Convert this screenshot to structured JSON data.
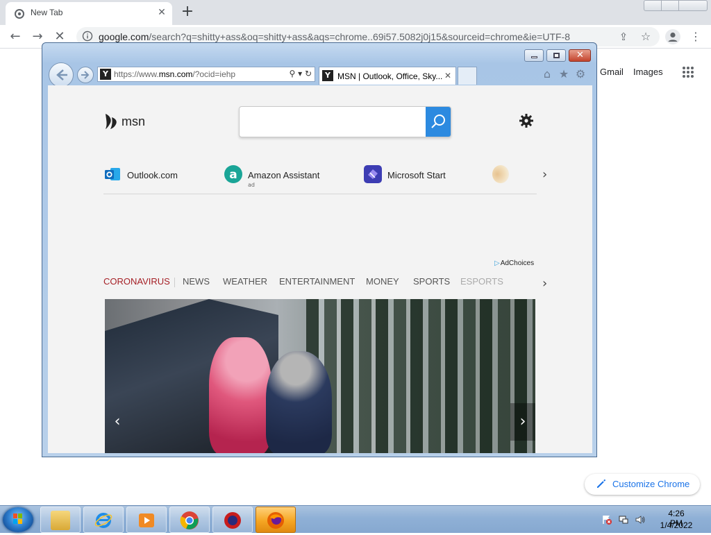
{
  "chrome": {
    "tab_title": "New Tab",
    "new_tab_glyph": "+",
    "omnibox": {
      "host": "google.com",
      "path": "/search?q=shitty+ass&oq=shitty+ass&aqs=chrome..69i57.5082j0j15&sourceid=chrome&ie=UTF-8"
    },
    "google_links": [
      "Gmail",
      "Images"
    ],
    "customize_label": "Customize Chrome"
  },
  "ie": {
    "address_prefix": "https://www.",
    "address_host": "msn.com",
    "address_path": "/?ocid=iehp",
    "tab_title": "MSN | Outlook, Office, Sky...",
    "tab_close": "✕",
    "favicon_letter": "Y"
  },
  "msn": {
    "logo_text": "msn",
    "search": {
      "value": "",
      "placeholder": ""
    },
    "tiles": [
      {
        "label": "Outlook.com",
        "icon": "outlook-icon",
        "color": "#0f6cbd",
        "ad": ""
      },
      {
        "label": "Amazon Assistant",
        "icon": "amazon-assistant-icon",
        "color": "#1aa597",
        "ad": "ad"
      },
      {
        "label": "Microsoft Start",
        "icon": "microsoft-start-icon",
        "color": "#4b4bc4",
        "ad": ""
      }
    ],
    "adchoices": "AdChoices",
    "nav": [
      "CORONAVIRUS",
      "NEWS",
      "WEATHER",
      "ENTERTAINMENT",
      "MONEY",
      "SPORTS",
      "ESPORTS"
    ],
    "accent": "#a51f25",
    "search_button_color": "#2c8ae0"
  },
  "taskbar": {
    "apps": [
      "file-explorer-icon",
      "internet-explorer-icon",
      "media-player-icon",
      "chrome-icon",
      "app-icon",
      "firefox-icon"
    ],
    "time": "4:26 PM",
    "date": "1/4/2022"
  }
}
